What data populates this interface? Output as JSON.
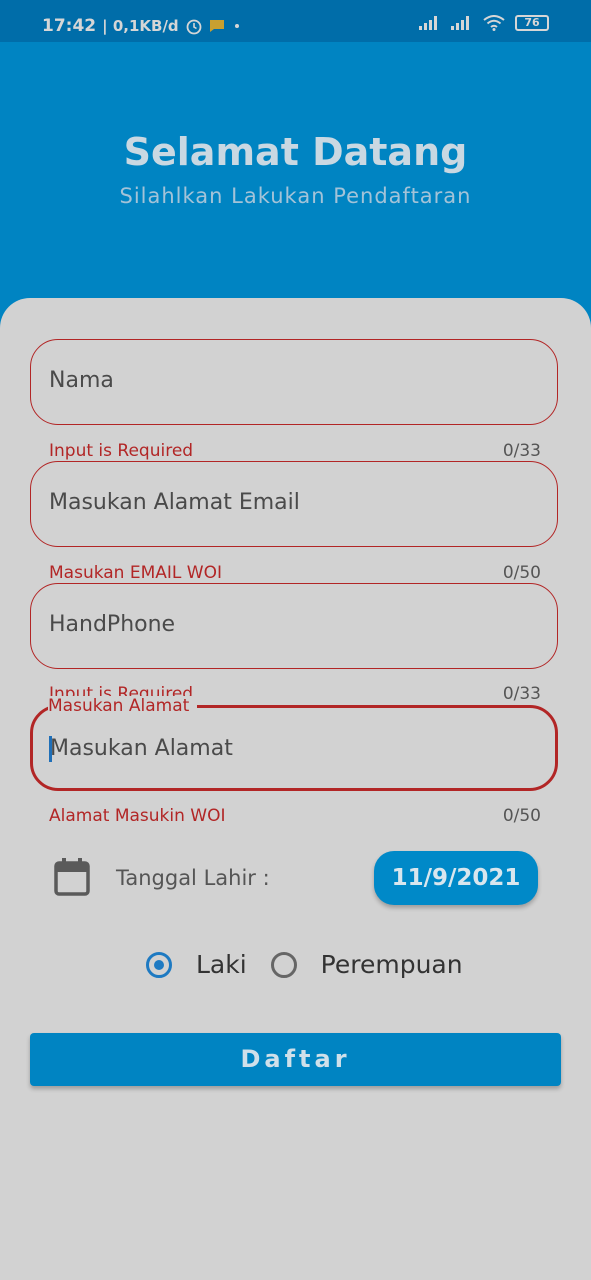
{
  "status": {
    "time": "17:42",
    "speed": "| 0,1KB/d",
    "battery": "76",
    "icons": [
      "alarm-icon",
      "message-icon",
      "dot-icon",
      "signal-icon",
      "signal-icon",
      "wifi-icon",
      "battery-icon"
    ]
  },
  "header": {
    "title": "Selamat Datang",
    "subtitle": "Silahlkan Lakukan Pendaftaran"
  },
  "form": {
    "nama": {
      "placeholder": "Nama",
      "helper": "Input is Required",
      "counter": "0/33"
    },
    "email": {
      "placeholder": "Masukan Alamat Email",
      "helper": "Masukan EMAIL WOI",
      "counter": "0/50"
    },
    "phone": {
      "placeholder": "HandPhone",
      "helper": "Input is Required",
      "counter": "0/33"
    },
    "alamat": {
      "label": "Masukan Alamat",
      "placeholder": "Masukan Alamat",
      "helper": "Alamat Masukin WOI",
      "counter": "0/50"
    },
    "tanggal_label": "Tanggal Lahir :",
    "tanggal_value": "11/9/2021",
    "gender": {
      "option1": "Laki",
      "option2": "Perempuan",
      "selected": "Laki"
    },
    "submit_label": "Daftar"
  },
  "colors": {
    "primary": "#0084c2",
    "error": "#b22626",
    "radio": "#1e7ac2"
  }
}
